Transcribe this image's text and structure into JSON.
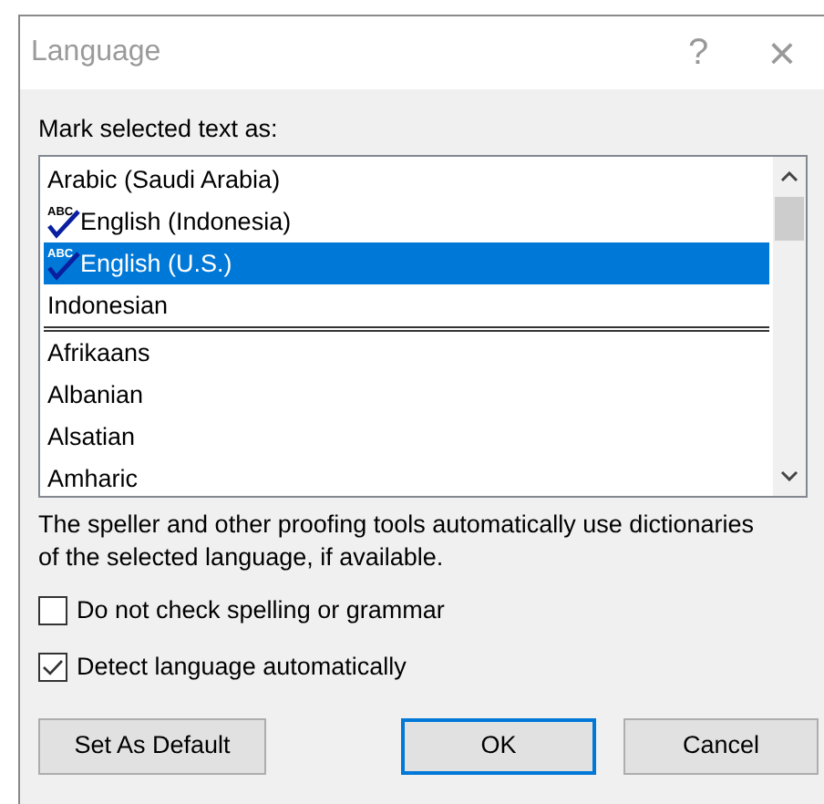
{
  "window": {
    "title": "Language",
    "help": "?",
    "close": "×"
  },
  "list_label": "Mark selected text as:",
  "languages": [
    {
      "name": "Arabic (Saudi Arabia)",
      "selected": false,
      "divider_after": false
    },
    {
      "name": "English (Indonesia)",
      "proofing_icon_text": "ABC",
      "selected": false,
      "divider_after": false
    },
    {
      "name": "English (U.S.)",
      "proofing_icon_text": "ABC",
      "selected": true,
      "divider_after": false
    },
    {
      "name": "Indonesian",
      "selected": false,
      "divider_after": true
    },
    {
      "name": "Afrikaans",
      "selected": false,
      "divider_after": false
    },
    {
      "name": "Albanian",
      "selected": false,
      "divider_after": false
    },
    {
      "name": "Alsatian",
      "selected": false,
      "divider_after": false
    },
    {
      "name": "Amharic",
      "selected": false,
      "divider_after": false
    }
  ],
  "description": "The speller and other proofing tools automatically use dictionaries of the selected language, if available.",
  "options": [
    {
      "label": "Do not check spelling or grammar",
      "checked": false
    },
    {
      "label": "Detect language automatically",
      "checked": true
    }
  ],
  "buttons": [
    {
      "label": "Set As Default",
      "default": false
    },
    {
      "label": "OK",
      "default": true
    },
    {
      "label": "Cancel",
      "default": false
    }
  ]
}
